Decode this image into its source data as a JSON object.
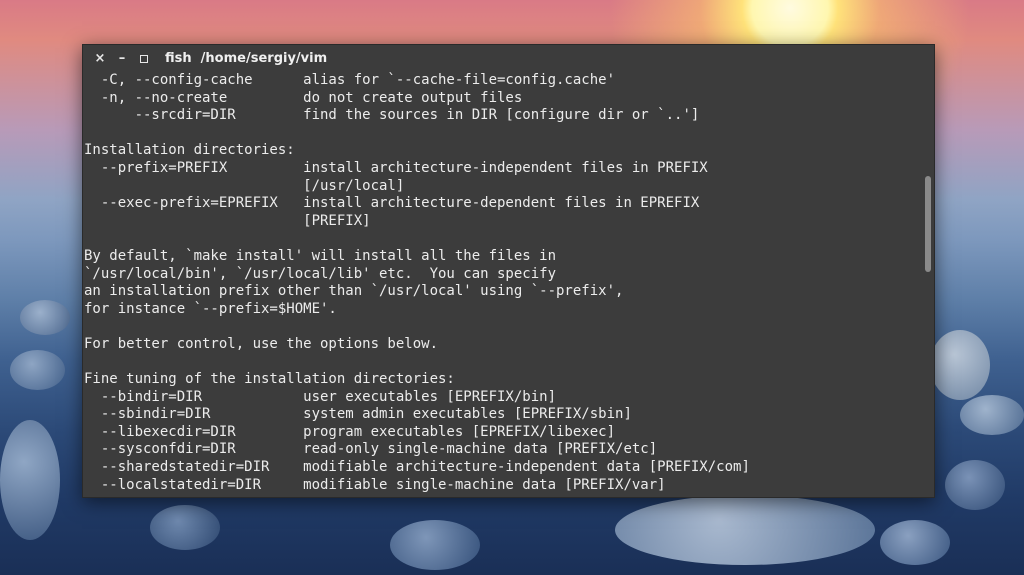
{
  "window": {
    "title": "fish  /home/sergiy/vim",
    "controls": {
      "close": "×",
      "minimize": "–",
      "maximize": "maximize-icon"
    }
  },
  "terminal": {
    "lines": [
      "  -C, --config-cache      alias for `--cache-file=config.cache'",
      "  -n, --no-create         do not create output files",
      "      --srcdir=DIR        find the sources in DIR [configure dir or `..']",
      "",
      "Installation directories:",
      "  --prefix=PREFIX         install architecture-independent files in PREFIX",
      "                          [/usr/local]",
      "  --exec-prefix=EPREFIX   install architecture-dependent files in EPREFIX",
      "                          [PREFIX]",
      "",
      "By default, `make install' will install all the files in",
      "`/usr/local/bin', `/usr/local/lib' etc.  You can specify",
      "an installation prefix other than `/usr/local' using `--prefix',",
      "for instance `--prefix=$HOME'.",
      "",
      "For better control, use the options below.",
      "",
      "Fine tuning of the installation directories:",
      "  --bindir=DIR            user executables [EPREFIX/bin]",
      "  --sbindir=DIR           system admin executables [EPREFIX/sbin]",
      "  --libexecdir=DIR        program executables [EPREFIX/libexec]",
      "  --sysconfdir=DIR        read-only single-machine data [PREFIX/etc]",
      "  --sharedstatedir=DIR    modifiable architecture-independent data [PREFIX/com]",
      "  --localstatedir=DIR     modifiable single-machine data [PREFIX/var]"
    ]
  },
  "colors": {
    "terminal_bg": "#3c3c3c",
    "terminal_fg": "#ececec"
  }
}
